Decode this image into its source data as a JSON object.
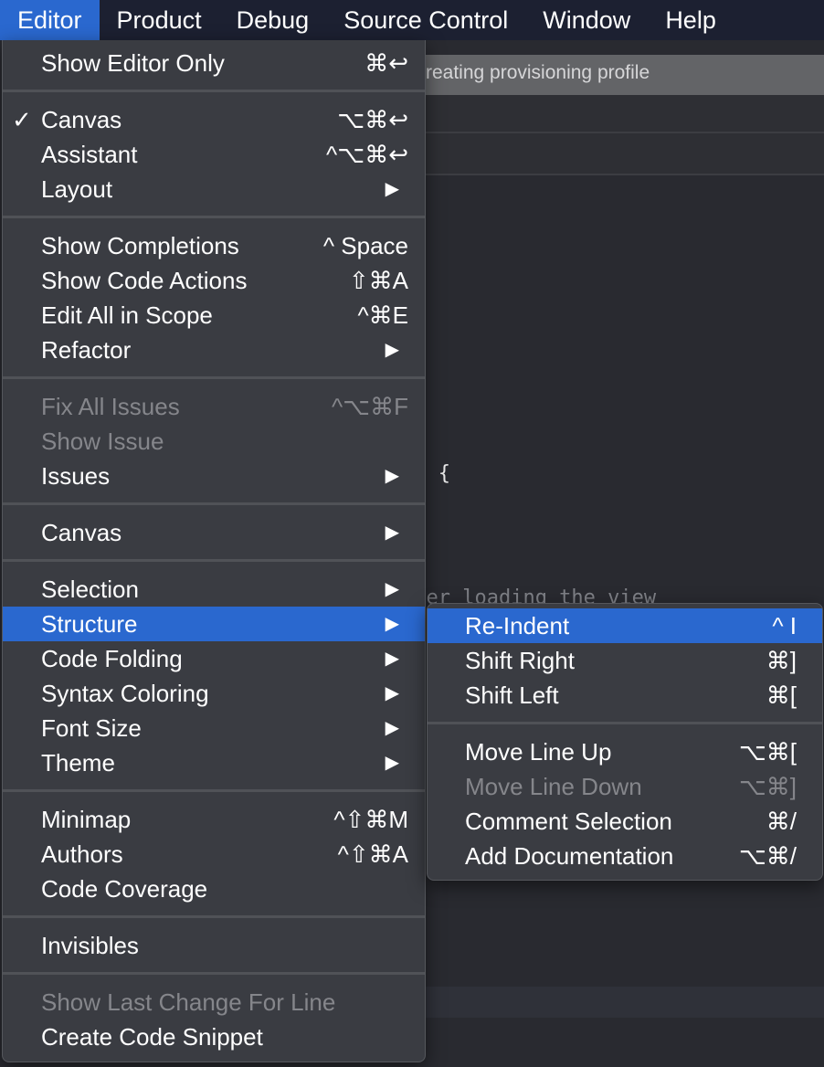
{
  "menubar": [
    {
      "label": "Editor",
      "active": true
    },
    {
      "label": "Product"
    },
    {
      "label": "Debug"
    },
    {
      "label": "Source Control"
    },
    {
      "label": "Window"
    },
    {
      "label": "Help"
    }
  ],
  "background": {
    "status_text": "reating provisioning profile",
    "code_line1_keyword": "er",
    "code_line1_brace": " {",
    "code_line2": "fter loading the view"
  },
  "colors": {
    "highlight": "#2a68cf",
    "menu_bg": "#3a3c42",
    "menubar_bg": "#1c2031",
    "disabled_text": "#85868b"
  },
  "editor_menu": [
    {
      "label": "Show Editor Only",
      "shortcut": "⌘↩"
    },
    {
      "sep": true
    },
    {
      "label": "Canvas",
      "shortcut": "⌥⌘↩",
      "checked": true
    },
    {
      "label": "Assistant",
      "shortcut": "^⌥⌘↩"
    },
    {
      "label": "Layout",
      "submenu": true
    },
    {
      "sep": true
    },
    {
      "label": "Show Completions",
      "shortcut": "^ Space"
    },
    {
      "label": "Show Code Actions",
      "shortcut": "⇧⌘A"
    },
    {
      "label": "Edit All in Scope",
      "shortcut": "^⌘E"
    },
    {
      "label": "Refactor",
      "submenu": true
    },
    {
      "sep": true
    },
    {
      "label": "Fix All Issues",
      "shortcut": "^⌥⌘F",
      "disabled": true
    },
    {
      "label": "Show Issue",
      "disabled": true
    },
    {
      "label": "Issues",
      "submenu": true
    },
    {
      "sep": true
    },
    {
      "label": "Canvas",
      "submenu": true
    },
    {
      "sep": true
    },
    {
      "label": "Selection",
      "submenu": true
    },
    {
      "label": "Structure",
      "submenu": true,
      "highlighted": true
    },
    {
      "label": "Code Folding",
      "submenu": true
    },
    {
      "label": "Syntax Coloring",
      "submenu": true
    },
    {
      "label": "Font Size",
      "submenu": true
    },
    {
      "label": "Theme",
      "submenu": true
    },
    {
      "sep": true
    },
    {
      "label": "Minimap",
      "shortcut": "^⇧⌘M"
    },
    {
      "label": "Authors",
      "shortcut": "^⇧⌘A"
    },
    {
      "label": "Code Coverage"
    },
    {
      "sep": true
    },
    {
      "label": "Invisibles"
    },
    {
      "sep": true
    },
    {
      "label": "Show Last Change For Line",
      "disabled": true
    },
    {
      "label": "Create Code Snippet"
    }
  ],
  "structure_submenu": [
    {
      "label": "Re-Indent",
      "shortcut": "^ I",
      "highlighted": true
    },
    {
      "label": "Shift Right",
      "shortcut": "⌘]"
    },
    {
      "label": "Shift Left",
      "shortcut": "⌘["
    },
    {
      "sep": true
    },
    {
      "label": "Move Line Up",
      "shortcut": "⌥⌘["
    },
    {
      "label": "Move Line Down",
      "shortcut": "⌥⌘]",
      "disabled": true
    },
    {
      "label": "Comment Selection",
      "shortcut": "⌘/"
    },
    {
      "label": "Add Documentation",
      "shortcut": "⌥⌘/"
    }
  ]
}
